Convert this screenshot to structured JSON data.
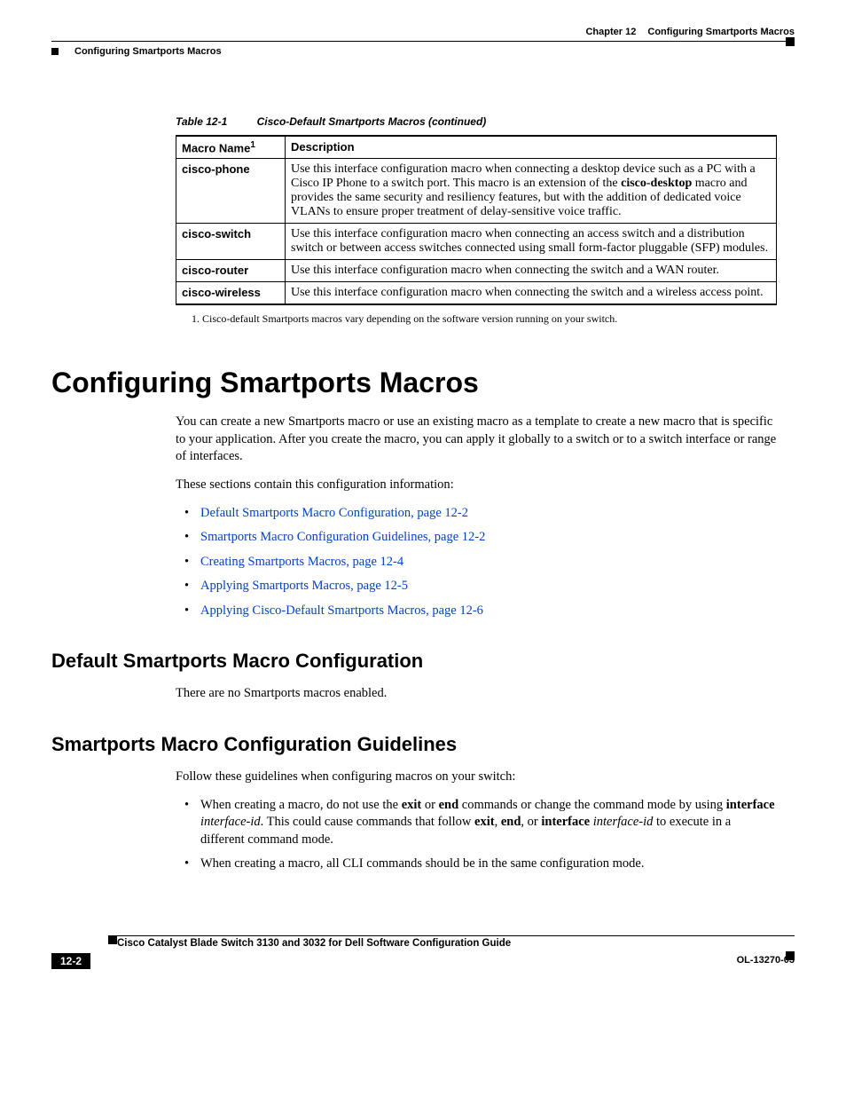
{
  "header": {
    "chapter_label": "Chapter 12",
    "chapter_title": "Configuring Smartports Macros",
    "running_head_left": "Configuring Smartports Macros"
  },
  "table": {
    "number": "Table 12-1",
    "title": "Cisco-Default Smartports Macros (continued)",
    "col1_label": "Macro Name",
    "col1_sup": "1",
    "col2_label": "Description",
    "rows": [
      {
        "name": "cisco-phone",
        "desc_pre": "Use this interface configuration macro when connecting a desktop device such as a PC with a Cisco IP Phone to a switch port. This macro is an extension of the ",
        "desc_bold": "cisco-desktop",
        "desc_post": " macro and provides the same security and resiliency features, but with the addition of dedicated voice VLANs to ensure proper treatment of delay-sensitive voice traffic."
      },
      {
        "name": "cisco-switch",
        "desc_pre": "Use this interface configuration macro when connecting an access switch and a distribution switch or between access switches connected using small form-factor pluggable (SFP) modules.",
        "desc_bold": "",
        "desc_post": ""
      },
      {
        "name": "cisco-router",
        "desc_pre": "Use this interface configuration macro when connecting the switch and a WAN router.",
        "desc_bold": "",
        "desc_post": ""
      },
      {
        "name": "cisco-wireless",
        "desc_pre": "Use this interface configuration macro when connecting the switch and a wireless access point.",
        "desc_bold": "",
        "desc_post": ""
      }
    ],
    "footnote": "1.   Cisco-default Smartports macros vary depending on the software version running on your switch."
  },
  "section": {
    "h1": "Configuring Smartports Macros",
    "intro": "You can create a new Smartports macro or use an existing macro as a template to create a new macro that is specific to your application. After you create the macro, you can apply it globally to a switch or to a switch interface or range of interfaces.",
    "list_intro": "These sections contain this configuration information:",
    "links": [
      "Default Smartports Macro Configuration, page 12-2",
      "Smartports Macro Configuration Guidelines, page 12-2",
      "Creating Smartports Macros, page 12-4",
      "Applying Smartports Macros, page 12-5",
      "Applying Cisco-Default Smartports Macros, page 12-6"
    ]
  },
  "sub1": {
    "title": "Default Smartports Macro Configuration",
    "body": "There are no Smartports macros enabled."
  },
  "sub2": {
    "title": "Smartports Macro Configuration Guidelines",
    "intro": "Follow these guidelines when configuring macros on your switch:",
    "b1_t1": "When creating a macro, do not use the ",
    "b1_b1": "exit",
    "b1_t2": " or ",
    "b1_b2": "end",
    "b1_t3": " commands or change the command mode by using ",
    "b1_b3": "interface",
    "b1_i1": " interface-id",
    "b1_t4": ". This could cause commands that follow ",
    "b1_b4": "exit",
    "b1_t5": ", ",
    "b1_b5": "end",
    "b1_t6": ", or ",
    "b1_b6": "interface",
    "b1_i2": " interface-id",
    "b1_t7": " to execute in a different command mode.",
    "b2": "When creating a macro, all CLI commands should be in the same configuration mode."
  },
  "footer": {
    "guide_title": "Cisco Catalyst Blade Switch 3130 and 3032 for Dell Software Configuration Guide",
    "page_num": "12-2",
    "ol": "OL-13270-03"
  }
}
